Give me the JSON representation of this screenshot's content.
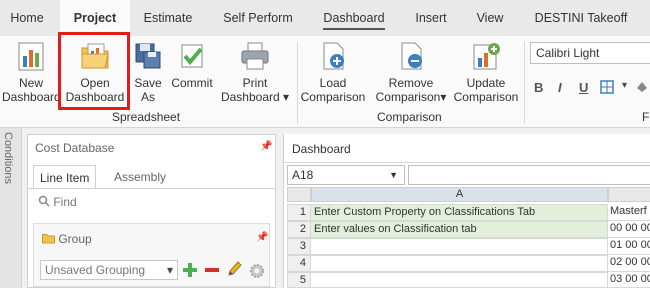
{
  "menu": {
    "tabs": [
      "Home",
      "Project",
      "Estimate",
      "Self Perform",
      "Dashboard",
      "Insert",
      "View",
      "DESTINI Takeoff"
    ]
  },
  "ribbon": {
    "buttons": {
      "new_dashboard": [
        "New",
        "Dashboard"
      ],
      "open_dashboard": [
        "Open",
        "Dashboard"
      ],
      "save_as": [
        "Save",
        "As"
      ],
      "commit": [
        "Commit"
      ],
      "print_dashboard": [
        "Print",
        "Dashboard"
      ],
      "load_comparison": [
        "Load",
        "Comparison"
      ],
      "remove_comparison": [
        "Remove",
        "Comparison"
      ],
      "update_comparison": [
        "Update",
        "Comparison"
      ]
    },
    "groups": {
      "spreadsheet": "Spreadsheet",
      "comparison": "Comparison",
      "format": "Fo"
    },
    "font": "Calibri Light",
    "format_buttons": [
      "B",
      "I",
      "U"
    ]
  },
  "side_strip": {
    "label": "Conditions"
  },
  "cost_panel": {
    "title": "Cost Database",
    "tabs": [
      "Line Item",
      "Assembly"
    ],
    "find_placeholder": "Find",
    "group_title": "Group",
    "grouping_value": "Unsaved Grouping"
  },
  "dashboard": {
    "title": "Dashboard",
    "cell_ref": "A18",
    "column_a": "A",
    "rows": [
      {
        "num": "1",
        "a": "Enter Custom Property on Classifications Tab",
        "b": "Masterf"
      },
      {
        "num": "2",
        "a": "Enter values on Classification tab",
        "b": "00 00 00"
      },
      {
        "num": "3",
        "a": "",
        "b": "01 00 00"
      },
      {
        "num": "4",
        "a": "",
        "b": "02 00 00"
      },
      {
        "num": "5",
        "a": "",
        "b": "03 00 00"
      }
    ]
  },
  "colors": {
    "highlight": "#e31b1b",
    "green_cell": "#e2efda"
  }
}
